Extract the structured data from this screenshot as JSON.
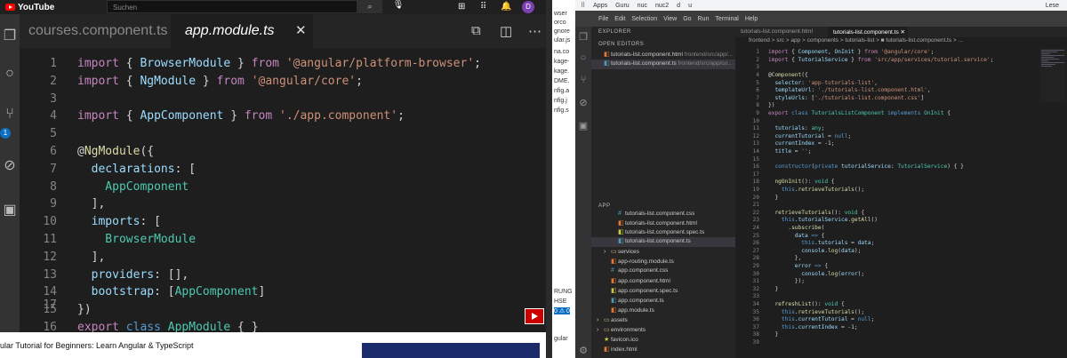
{
  "youtube": {
    "logo_text": "YouTube",
    "search_placeholder": "Suchen",
    "avatar_letter": "D",
    "video_title": "ular Tutorial for Beginners: Learn Angular & TypeScript"
  },
  "video_editor": {
    "tabs": [
      {
        "label": "courses.component.ts"
      },
      {
        "label": "app.module.ts"
      }
    ],
    "activity_badge": "1",
    "line_numbers": [
      "1",
      "2",
      "3",
      "4",
      "5",
      "6",
      "7",
      "8",
      "9",
      "10",
      "11",
      "12",
      "13",
      "14",
      "15",
      "16",
      "17"
    ]
  },
  "overlap_text": [
    "wser",
    "orco",
    "gnore",
    "ular.js",
    "na.co",
    "kage-",
    "kage.",
    "DME.",
    "nfig.a",
    "nfig.j",
    "nfig.s",
    "RUNG",
    "HSE",
    "0 ⚠ 0",
    "gular"
  ],
  "browser": {
    "bookmarks": [
      "Apps",
      "Guru",
      "nuc",
      "nuc2",
      "d",
      "u",
      "Lese"
    ],
    "menu": [
      "File",
      "Edit",
      "Selection",
      "View",
      "Go",
      "Run",
      "Terminal",
      "Help"
    ],
    "explorer_label": "EXPLORER",
    "open_editors_label": "OPEN EDITORS",
    "open_editors": [
      {
        "name": "tutorials-list.component.html",
        "path": "frontend/src/app/..."
      },
      {
        "name": "tutorials-list.component.ts",
        "path": "frontend/src/app/co..."
      }
    ],
    "app_label": "APP",
    "app_files": [
      "tutorials-list.component.css",
      "tutorials-list.component.html",
      "tutorials-list.component.spec.ts",
      "tutorials-list.component.ts",
      "services",
      "app-routing.module.ts",
      "app.component.css",
      "app.component.html",
      "app.component.spec.ts",
      "app.component.ts",
      "app.module.ts",
      "assets",
      "environments",
      "favicon.ico",
      "index.html"
    ],
    "editor_tabs": [
      "tutorials-list.component.html",
      "tutorials-list.component.ts"
    ],
    "breadcrumb": "frontend > src > app > components > tutorials-list > ■ tutorials-list.component.ts > ..."
  },
  "colors": {
    "keyword": "#c586c0",
    "type": "#4ec9b0",
    "string": "#ce9178",
    "decorator": "#dcdcaa",
    "variable": "#9cdcfe"
  }
}
